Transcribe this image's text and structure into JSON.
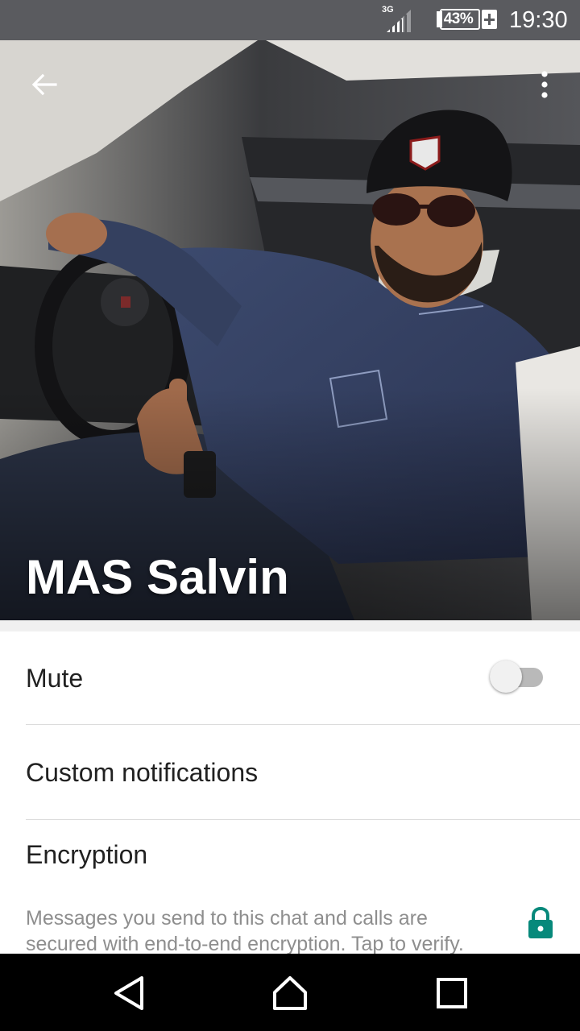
{
  "status_bar": {
    "network": "3G",
    "battery_percent": "43%",
    "time": "19:30",
    "icons": [
      "signal-icon",
      "battery-charging-icon"
    ]
  },
  "header": {
    "contact_name": "MAS Salvin",
    "icons": [
      "back-arrow-icon",
      "more-vert-icon"
    ]
  },
  "settings": {
    "mute_label": "Mute",
    "mute_on": false,
    "custom_notifications_label": "Custom notifications",
    "encryption_title": "Encryption",
    "encryption_desc": "Messages you send to this chat and calls are secured with end-to-end encryption. Tap to verify.",
    "encryption_icon": "lock-icon",
    "accent_color": "#07897b"
  },
  "nav_bar": {
    "icons": [
      "back-triangle-icon",
      "home-icon",
      "recents-icon"
    ]
  }
}
